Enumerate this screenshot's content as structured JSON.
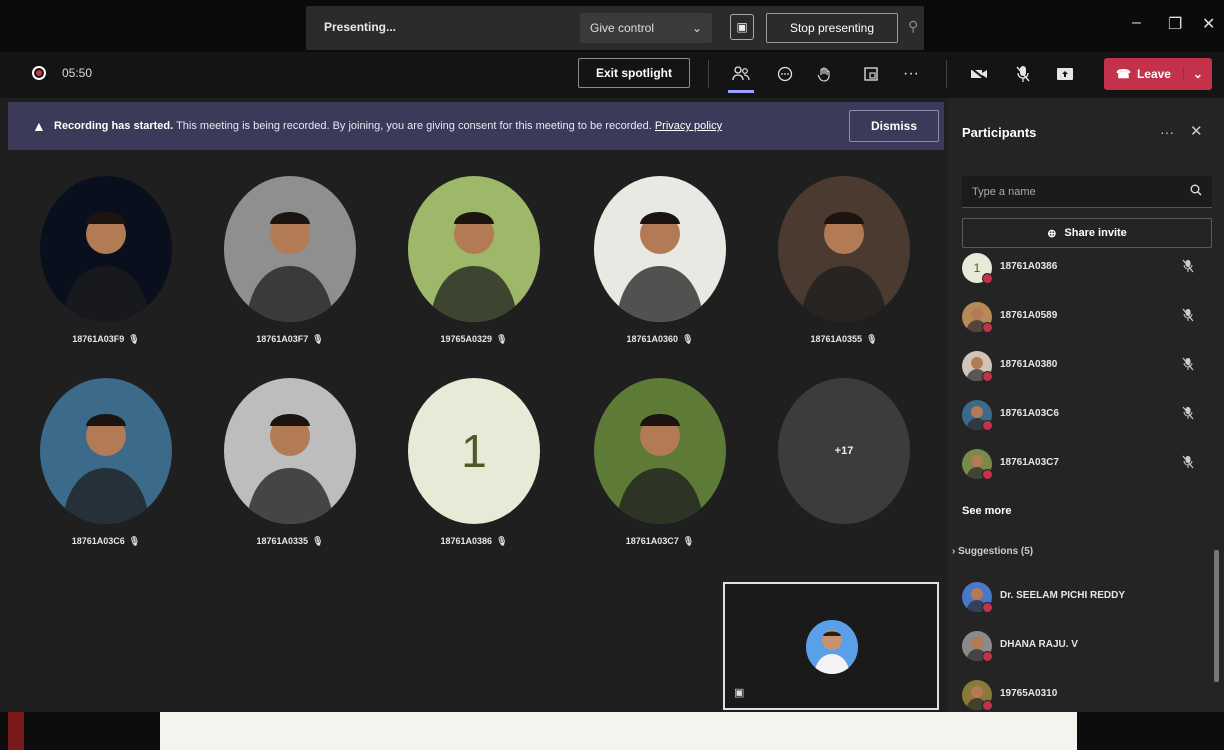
{
  "titlebar": {
    "presenting_label": "Presenting...",
    "give_control_label": "Give control",
    "stop_presenting_label": "Stop presenting"
  },
  "toolbar": {
    "timer": "05:50",
    "exit_spotlight_label": "Exit spotlight",
    "leave_label": "Leave",
    "more_label": "···"
  },
  "banner": {
    "bold_text": "Recording has started.",
    "text": "This meeting is being recorded. By joining, you are giving consent for this meeting to be recorded.",
    "link": "Privacy policy",
    "dismiss_label": "Dismiss"
  },
  "gallery": {
    "tiles": [
      {
        "name": "18761A03F9",
        "kind": "photo",
        "bg": "#0a0f1e"
      },
      {
        "name": "18761A03F7",
        "kind": "photo",
        "bg": "#8f8f8f"
      },
      {
        "name": "19765A0329",
        "kind": "photo",
        "bg": "#9db868"
      },
      {
        "name": "18761A0360",
        "kind": "photo",
        "bg": "#e9e9e4"
      },
      {
        "name": "18761A0355",
        "kind": "photo",
        "bg": "#4a3a30"
      },
      {
        "name": "18761A03C6",
        "kind": "photo",
        "bg": "#3c6a8a"
      },
      {
        "name": "18761A0335",
        "kind": "photo",
        "bg": "#bdbdbd"
      },
      {
        "name": "18761A0386",
        "kind": "initial",
        "initial": "1"
      },
      {
        "name": "18761A03C7",
        "kind": "photo",
        "bg": "#5d7a36"
      },
      {
        "name": "",
        "kind": "overflow",
        "overflow": "+17"
      }
    ]
  },
  "panel": {
    "title": "Participants",
    "search_placeholder": "Type a name",
    "share_invite_label": "Share invite",
    "participants": [
      {
        "name": "18761A0386",
        "avatar_bg": "#e6ead6",
        "initial": "1"
      },
      {
        "name": "18761A0589",
        "avatar_bg": "#b88a5a"
      },
      {
        "name": "18761A0380",
        "avatar_bg": "#d0c4b8"
      },
      {
        "name": "18761A03C6",
        "avatar_bg": "#3c6a8a"
      },
      {
        "name": "18761A03C7",
        "avatar_bg": "#7a8a4a"
      }
    ],
    "see_more_label": "See more",
    "suggestions_label": "Suggestions (5)",
    "suggestions": [
      {
        "name": "Dr. SEELAM PICHI REDDY",
        "avatar_bg": "#4a78c8"
      },
      {
        "name": "DHANA RAJU. V",
        "avatar_bg": "#8a8a8a"
      },
      {
        "name": "19765A0310",
        "avatar_bg": "#8a7a3a"
      }
    ]
  },
  "colors": {
    "accent": "#9ea2ff",
    "leave": "#c4314b",
    "banner": "#3b3a58"
  }
}
